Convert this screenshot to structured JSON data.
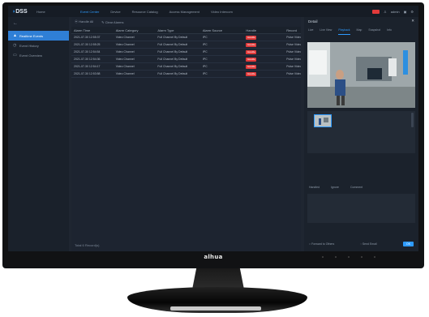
{
  "app": {
    "logo": "DSS",
    "home": "Home",
    "tabs": [
      "Event Center",
      "Device",
      "Resource Catalog",
      "Access Management",
      "Video Intercom"
    ],
    "user": "admin"
  },
  "nav": {
    "back_icon": "back-arrow-icon",
    "items": [
      {
        "label": "Realtime Events",
        "icon": "alarm-icon"
      },
      {
        "label": "Event History",
        "icon": "history-icon"
      },
      {
        "label": "Event Overview",
        "icon": "monitor-icon"
      }
    ]
  },
  "toolbar": {
    "handle_all": "Handle All",
    "refresh": "Clear Alarms"
  },
  "table": {
    "headers": [
      "Alarm Time",
      "Alarm Category",
      "Alarm Type",
      "Alarm Source",
      "Handle",
      "Record"
    ],
    "rows": [
      [
        "2021-07-30 12:55:37",
        "Video Channel",
        "Full Channel By Default",
        "IPC",
        "Handle",
        "Pulse Video"
      ],
      [
        "2021-07-30 12:55:25",
        "Video Channel",
        "Full Channel By Default",
        "IPC",
        "Handle",
        "Pulse Video"
      ],
      [
        "2021-07-30 12:54:54",
        "Video Channel",
        "Full Channel By Default",
        "IPC",
        "Handle",
        "Pulse Video"
      ],
      [
        "2021-07-30 12:54:36",
        "Video Channel",
        "Full Channel By Default",
        "IPC",
        "Handle",
        "Pulse Video"
      ],
      [
        "2021-07-30 12:54:17",
        "Video Channel",
        "Full Channel By Default",
        "IPC",
        "Handle",
        "Pulse Video"
      ],
      [
        "2021-07-30 12:53:58",
        "Video Channel",
        "Full Channel By Default",
        "IPC",
        "Handle",
        "Pulse Video"
      ]
    ],
    "footer": "Total 6 Record(s)"
  },
  "detail": {
    "title": "Detail",
    "tabs": [
      "Live",
      "Live View",
      "Playback",
      "Map",
      "Snapshot",
      "Info"
    ],
    "active_tab": "Playback",
    "labels": [
      "Handled",
      "Ignore",
      "Comment"
    ],
    "forward_label": "Forward to Others",
    "send_email_label": "Send Email",
    "ok_label": "OK"
  },
  "bezel": {
    "brand": "alhua"
  }
}
